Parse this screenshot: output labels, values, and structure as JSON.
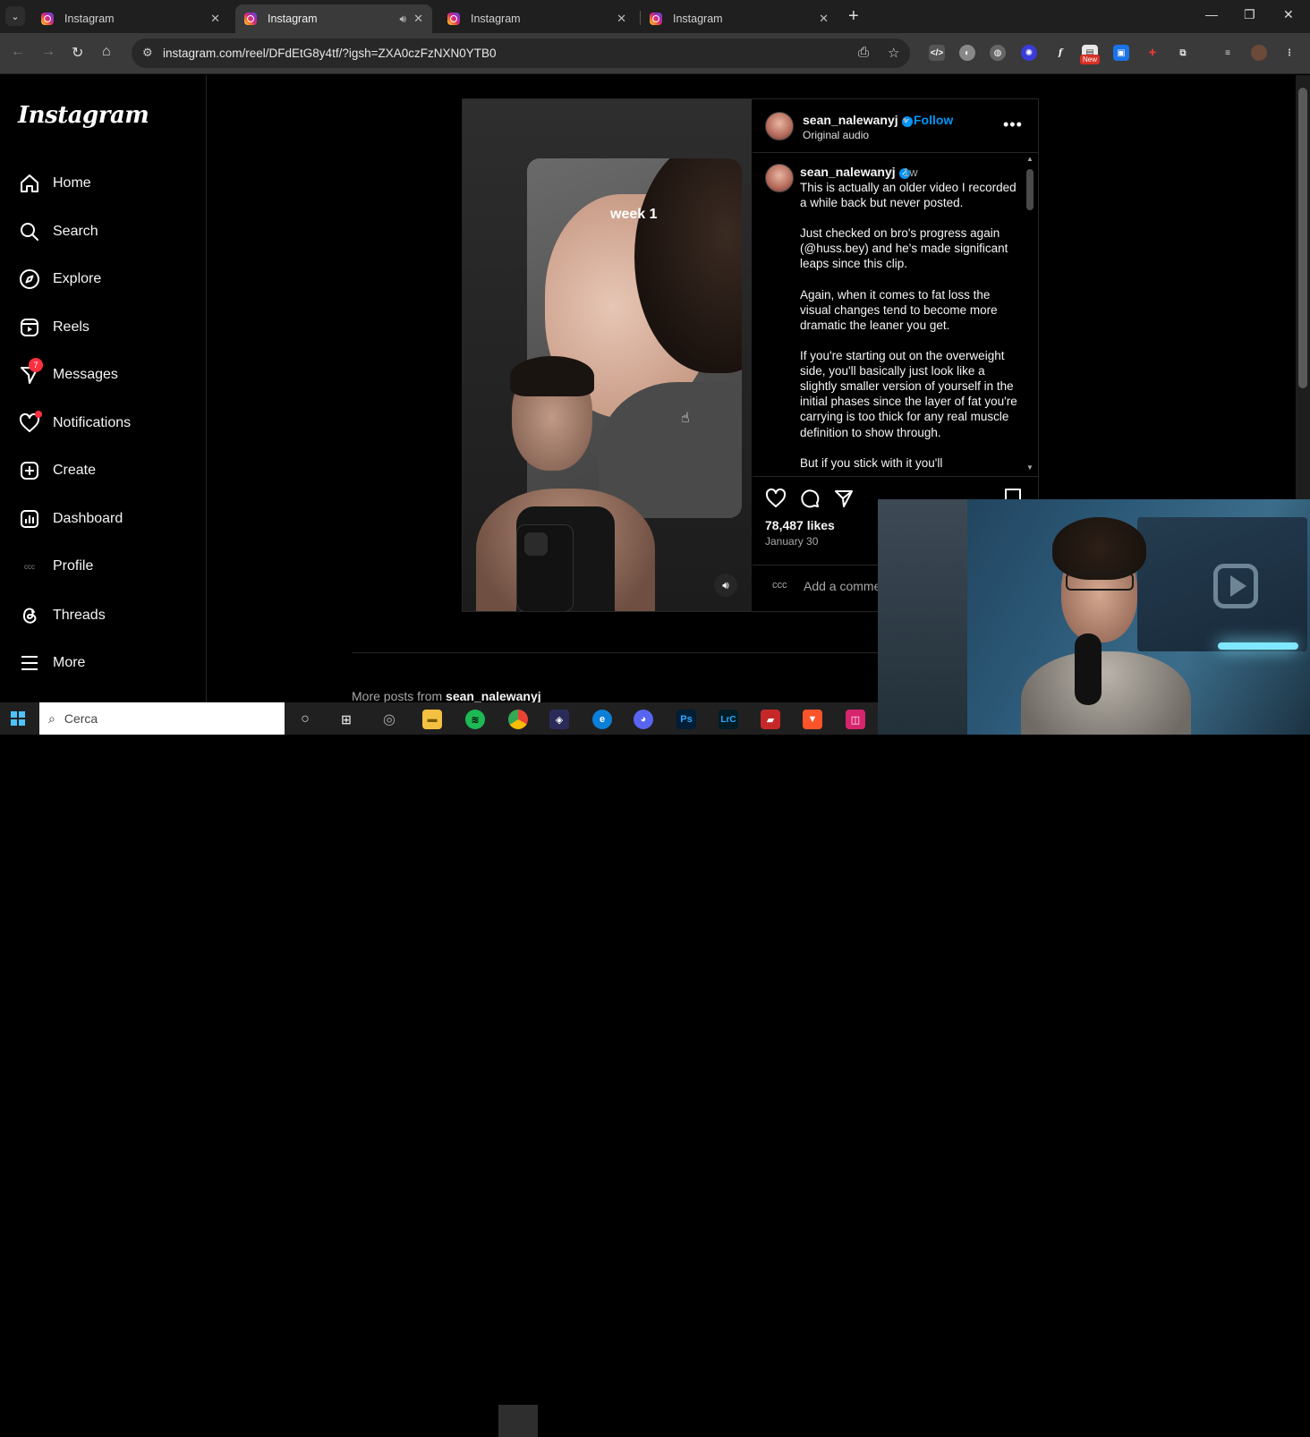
{
  "browser": {
    "tabs": [
      {
        "title": "Instagram",
        "active": false
      },
      {
        "title": "Instagram",
        "active": true
      },
      {
        "title": "Instagram",
        "active": false
      },
      {
        "title": "Instagram",
        "active": false
      }
    ],
    "url": "instagram.com/reel/DFdEtG8y4tf/?igsh=ZXA0czFzNXN0YTB0",
    "extension_badge": "New"
  },
  "sidebar": {
    "logo": "Instagram",
    "items": [
      {
        "label": "Home",
        "icon": "home-icon"
      },
      {
        "label": "Search",
        "icon": "search-icon"
      },
      {
        "label": "Explore",
        "icon": "compass-icon"
      },
      {
        "label": "Reels",
        "icon": "reels-icon"
      },
      {
        "label": "Messages",
        "icon": "messenger-icon",
        "badge": "7"
      },
      {
        "label": "Notifications",
        "icon": "heart-icon"
      },
      {
        "label": "Create",
        "icon": "plus-square-icon"
      },
      {
        "label": "Dashboard",
        "icon": "chart-icon"
      },
      {
        "label": "Profile",
        "icon": "avatar-icon"
      },
      {
        "label": "Threads",
        "icon": "threads-icon"
      },
      {
        "label": "More",
        "icon": "menu-icon"
      }
    ],
    "profile_avatar_text": "ccc"
  },
  "post": {
    "video_overlay_text": "week 1",
    "username": "sean_nalewanyj",
    "follow_label": "Follow",
    "separator": "•",
    "audio": "Original audio",
    "caption_time": "1w",
    "caption": "This is actually an older video I recorded a while back but never posted.\n\nJust checked on bro's progress again (@huss.bey) and he's made significant leaps since this clip.\n\nAgain, when it comes to fat loss the visual changes tend to become more dramatic the leaner you get.\n\nIf you're starting out on the overweight side, you'll basically just look like a slightly smaller version of yourself in the initial phases since the layer of fat you're carrying is too thick for any real muscle definition to show through.\n\nBut if you stick with it you'll",
    "likes": "78,487 likes",
    "date": "January 30",
    "comment_avatar_text": "ccc",
    "comment_placeholder": "Add a comme",
    "more_posts_prefix": "More posts from",
    "more_posts_user": "sean_nalewanyj"
  },
  "taskbar": {
    "search_placeholder": "Cerca"
  },
  "colors": {
    "accent": "#0095f6",
    "badge": "#ff3040",
    "background": "#000000"
  }
}
